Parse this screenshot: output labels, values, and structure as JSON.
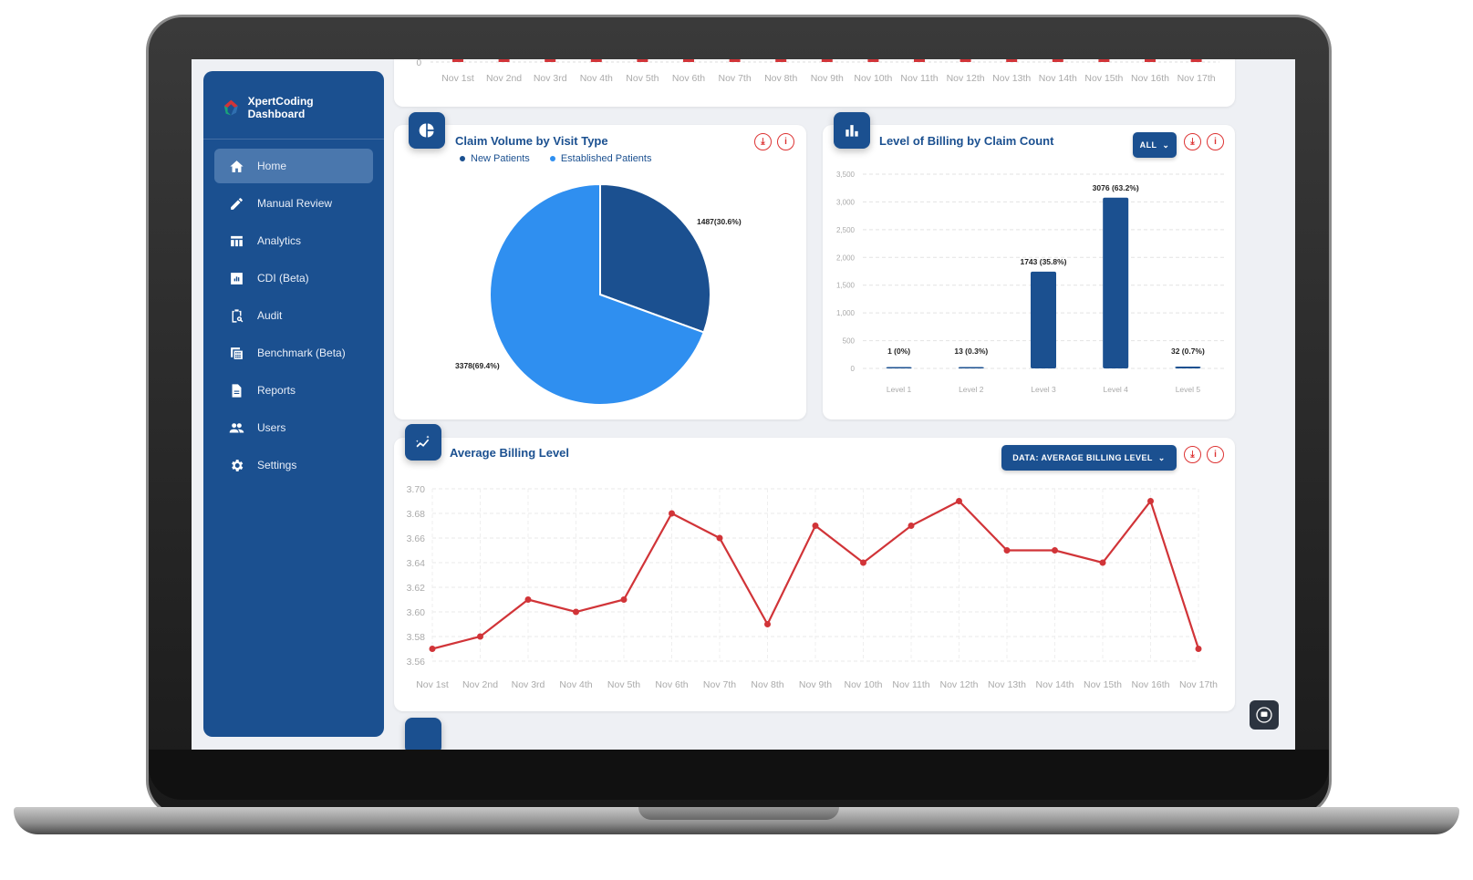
{
  "app": {
    "title": "XpertCoding Dashboard"
  },
  "sidebar": {
    "items": [
      {
        "label": "Home",
        "icon": "home-icon",
        "active": true
      },
      {
        "label": "Manual Review",
        "icon": "pencil-icon"
      },
      {
        "label": "Analytics",
        "icon": "table-icon"
      },
      {
        "label": "CDI (Beta)",
        "icon": "chart-box-icon"
      },
      {
        "label": "Audit",
        "icon": "clipboard-search-icon"
      },
      {
        "label": "Benchmark (Beta)",
        "icon": "calculator-icon"
      },
      {
        "label": "Reports",
        "icon": "document-icon"
      },
      {
        "label": "Users",
        "icon": "users-icon"
      },
      {
        "label": "Settings",
        "icon": "gear-icon"
      }
    ]
  },
  "top_chart": {
    "zero_label": "0",
    "x_labels": [
      "Nov 1st",
      "Nov 2nd",
      "Nov 3rd",
      "Nov 4th",
      "Nov 5th",
      "Nov 6th",
      "Nov 7th",
      "Nov 8th",
      "Nov 9th",
      "Nov 10th",
      "Nov 11th",
      "Nov 12th",
      "Nov 13th",
      "Nov 14th",
      "Nov 15th",
      "Nov 16th",
      "Nov 17th"
    ],
    "bar_color": "#d13438"
  },
  "pie_card": {
    "title": "Claim Volume by Visit Type",
    "download_icon": "download-icon",
    "info_icon": "info-icon"
  },
  "bar_card": {
    "title": "Level of Billing by Claim Count",
    "filter_label": "ALL"
  },
  "line_card": {
    "title": "Average Billing Level",
    "data_select_label": "DATA: AVERAGE BILLING LEVEL"
  },
  "chart_data": [
    {
      "type": "pie",
      "title": "Claim Volume by Visit Type",
      "legend": [
        "New Patients",
        "Established Patients"
      ],
      "legend_position": "top-left",
      "slices": [
        {
          "name": "New Patients",
          "value": 1487,
          "percent": 30.6,
          "label": "1487(30.6%)",
          "color": "#1b5090"
        },
        {
          "name": "Established Patients",
          "value": 3378,
          "percent": 69.4,
          "label": "3378(69.4%)",
          "color": "#2f8ff0"
        }
      ]
    },
    {
      "type": "bar",
      "title": "Level of Billing by Claim Count",
      "categories": [
        "Level 1",
        "Level 2",
        "Level 3",
        "Level 4",
        "Level 5"
      ],
      "values": [
        1,
        13,
        1743,
        3076,
        32
      ],
      "data_labels": [
        "1 (0%)",
        "13 (0.3%)",
        "1743 (35.8%)",
        "3076 (63.2%)",
        "32 (0.7%)"
      ],
      "ylim": [
        0,
        3500
      ],
      "yticks": [
        "0",
        "500",
        "1,000",
        "1,500",
        "2,000",
        "2,500",
        "3,000",
        "3,500"
      ],
      "grid": true,
      "color": "#1b5090"
    },
    {
      "type": "line",
      "title": "Average Billing Level",
      "x": [
        "Nov 1st",
        "Nov 2nd",
        "Nov 3rd",
        "Nov 4th",
        "Nov 5th",
        "Nov 6th",
        "Nov 7th",
        "Nov 8th",
        "Nov 9th",
        "Nov 10th",
        "Nov 11th",
        "Nov 12th",
        "Nov 13th",
        "Nov 14th",
        "Nov 15th",
        "Nov 16th",
        "Nov 17th"
      ],
      "values": [
        3.57,
        3.58,
        3.61,
        3.6,
        3.61,
        3.68,
        3.66,
        3.59,
        3.67,
        3.64,
        3.67,
        3.69,
        3.65,
        3.65,
        3.64,
        3.69,
        3.57
      ],
      "ylim": [
        3.56,
        3.7
      ],
      "yticks": [
        "3.56",
        "3.58",
        "3.60",
        "3.62",
        "3.64",
        "3.66",
        "3.68",
        "3.70"
      ],
      "grid": true,
      "color": "#d13438"
    }
  ]
}
